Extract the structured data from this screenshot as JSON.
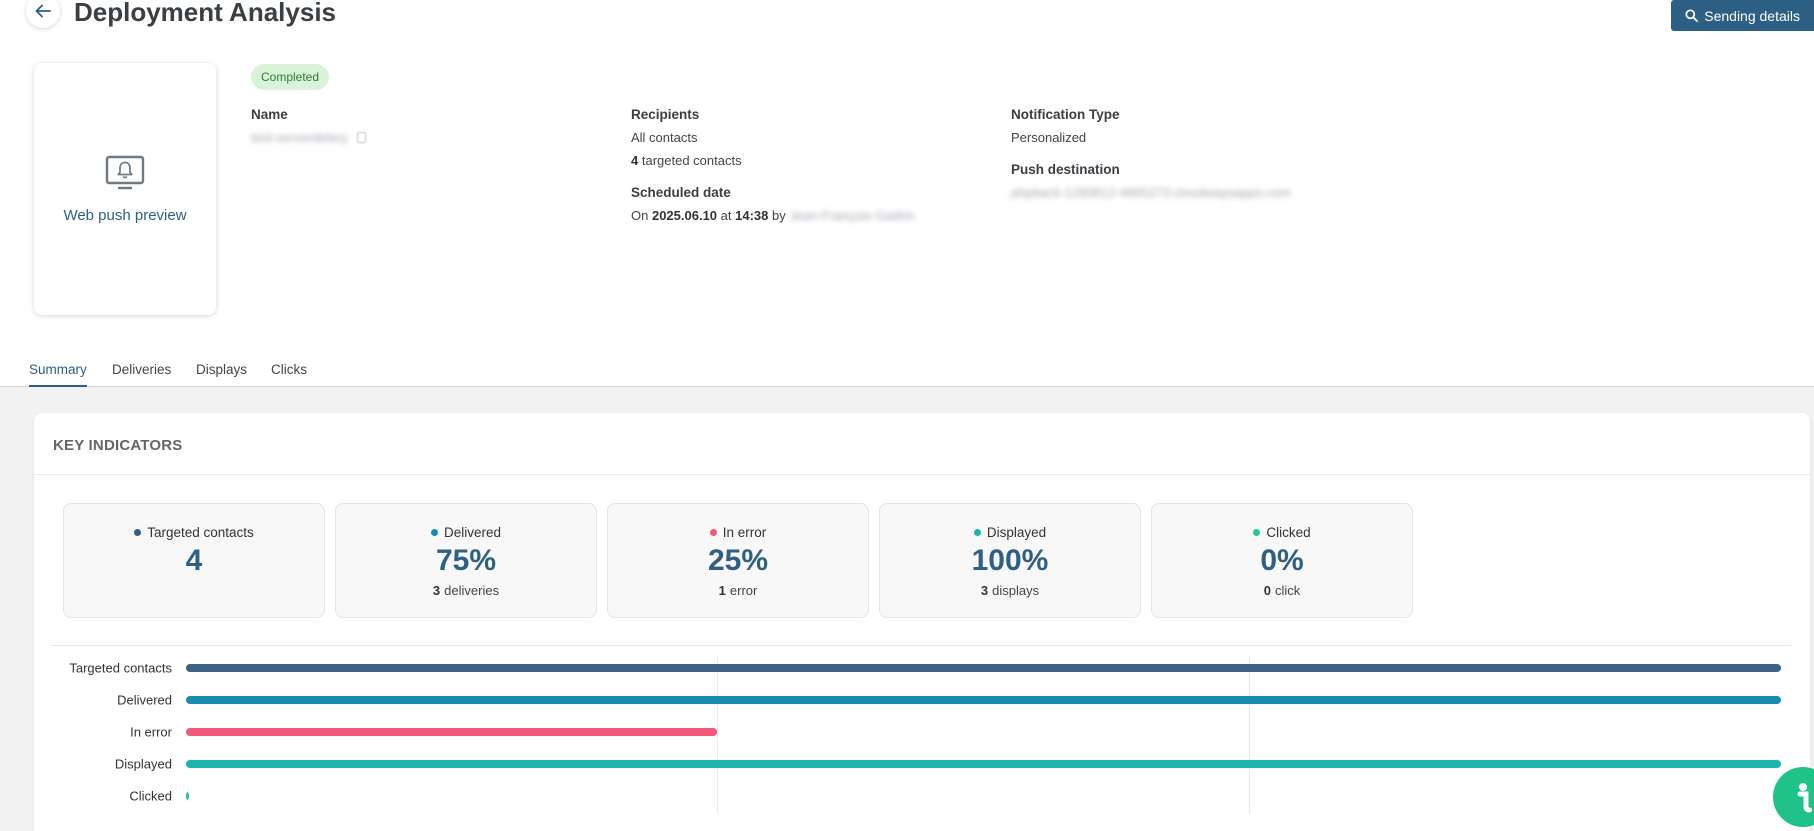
{
  "header": {
    "title": "Deployment Analysis",
    "sending_details_label": "Sending details"
  },
  "preview": {
    "label": "Web push preview"
  },
  "status": "Completed",
  "info": {
    "name_label": "Name",
    "name_value": "test-serverdelery",
    "recipients_label": "Recipients",
    "recipients_all": "All contacts",
    "targeted_count": "4",
    "targeted_suffix": "targeted contacts",
    "scheduled_label": "Scheduled date",
    "scheduled_prefix": "On",
    "scheduled_date": "2025.06.10",
    "scheduled_at": "at",
    "scheduled_time": "14:38",
    "scheduled_by": "by",
    "scheduled_user": "Jean-François Gadrin",
    "notification_type_label": "Notification Type",
    "notification_type_value": "Personalized",
    "push_destination_label": "Push destination",
    "push_destination_value": "phpback-1260812-4865273.cloudwaysapps.com"
  },
  "tabs": [
    {
      "label": "Summary",
      "active": true
    },
    {
      "label": "Deliveries",
      "active": false
    },
    {
      "label": "Displays",
      "active": false
    },
    {
      "label": "Clicks",
      "active": false
    }
  ],
  "key_indicators": {
    "title": "KEY INDICATORS",
    "cards": [
      {
        "label": "Targeted contacts",
        "value": "4",
        "sub_count": "",
        "sub_text": "",
        "color": "#2f5f82"
      },
      {
        "label": "Delivered",
        "value": "75%",
        "sub_count": "3",
        "sub_text": "deliveries",
        "color": "#1a8bb0"
      },
      {
        "label": "In error",
        "value": "25%",
        "sub_count": "1",
        "sub_text": "error",
        "color": "#f05a78"
      },
      {
        "label": "Displayed",
        "value": "100%",
        "sub_count": "3",
        "sub_text": "displays",
        "color": "#1bb5ad"
      },
      {
        "label": "Clicked",
        "value": "0%",
        "sub_count": "0",
        "sub_text": "click",
        "color": "#2bc48e"
      }
    ]
  },
  "chart_data": {
    "type": "bar",
    "orientation": "horizontal",
    "categories": [
      "Targeted contacts",
      "Delivered",
      "In error",
      "Displayed",
      "Clicked"
    ],
    "values": [
      100,
      100,
      33.3,
      100,
      0
    ],
    "colors": [
      "#3c6386",
      "#1a8bb0",
      "#f05a78",
      "#1bb5ad",
      "#2bc48e"
    ],
    "xlim": [
      0,
      100
    ],
    "grid": true
  }
}
